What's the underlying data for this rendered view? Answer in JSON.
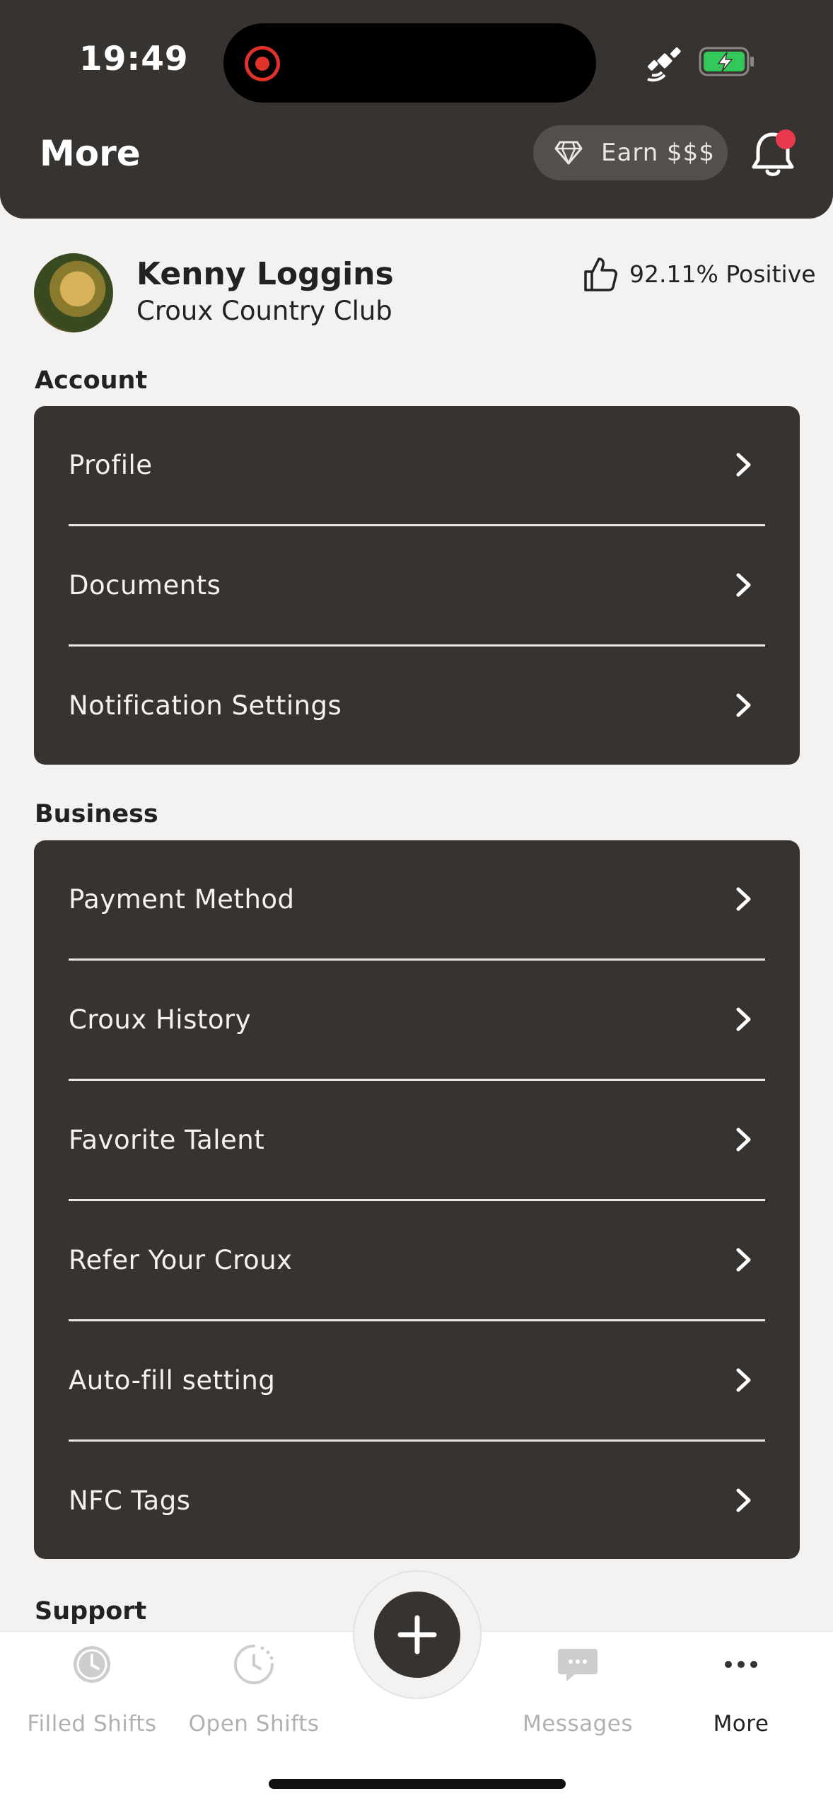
{
  "status_bar": {
    "time": "19:49"
  },
  "header": {
    "title": "More",
    "earn_button_label": "Earn $$$"
  },
  "profile": {
    "name": "Kenny Loggins",
    "organization": "Croux Country Club",
    "rating": "92.11% Positive"
  },
  "sections": {
    "account": {
      "label": "Account",
      "items": [
        "Profile",
        "Documents",
        "Notification Settings"
      ]
    },
    "business": {
      "label": "Business",
      "items": [
        "Payment Method",
        "Croux History",
        "Favorite Talent",
        "Refer Your Croux",
        "Auto-fill setting",
        "NFC Tags"
      ]
    },
    "support": {
      "label": "Support"
    }
  },
  "tabbar": {
    "filled_shifts": "Filled Shifts",
    "open_shifts": "Open Shifts",
    "messages": "Messages",
    "more": "More"
  },
  "colors": {
    "header_bg": "#373331",
    "card_bg": "#373331",
    "page_bg": "#f3f2f1",
    "notification_dot": "#e8394d",
    "battery_green": "#34c759"
  }
}
